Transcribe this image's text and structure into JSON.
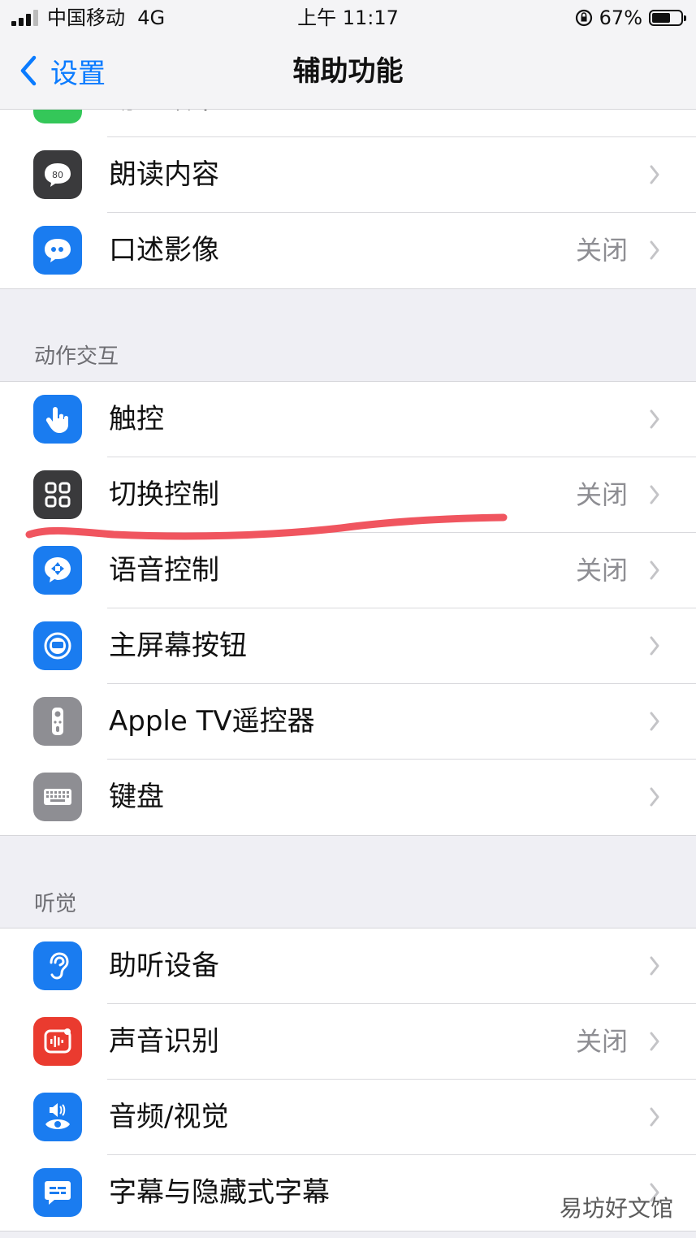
{
  "status_bar": {
    "carrier": "中国移动",
    "network": "4G",
    "time": "上午 11:17",
    "battery": "67%"
  },
  "nav": {
    "back_label": "设置",
    "title": "辅助功能"
  },
  "group_top": {
    "partial_label": "动态效果",
    "items": [
      {
        "label": "朗读内容",
        "value": ""
      },
      {
        "label": "口述影像",
        "value": "关闭"
      }
    ]
  },
  "section_motion": {
    "header": "动作交互",
    "items": [
      {
        "label": "触控",
        "value": ""
      },
      {
        "label": "切换控制",
        "value": "关闭"
      },
      {
        "label": "语音控制",
        "value": "关闭"
      },
      {
        "label": "主屏幕按钮",
        "value": ""
      },
      {
        "label": "Apple TV遥控器",
        "value": ""
      },
      {
        "label": "键盘",
        "value": ""
      }
    ]
  },
  "section_hearing": {
    "header": "听觉",
    "items": [
      {
        "label": "助听设备",
        "value": ""
      },
      {
        "label": "声音识别",
        "value": "关闭"
      },
      {
        "label": "音频/视觉",
        "value": ""
      },
      {
        "label": "字幕与隐藏式字幕",
        "value": ""
      }
    ]
  },
  "icons": {
    "spoken-content": "#3a3a3c",
    "audio-descriptions": "#1a7cf0",
    "touch": "#1a7cf0",
    "switch-control": "#3a3a3c",
    "voice-control": "#1a7cf0",
    "home-button": "#1a7cf0",
    "apple-tv-remote": "#8e8e93",
    "keyboard": "#8e8e93",
    "hearing-devices": "#1a7cf0",
    "sound-recognition": "#ea3b2f",
    "audio-visual": "#1a7cf0",
    "subtitles": "#1a7cf0"
  },
  "annotation_color": "#f0555f",
  "watermark": "易坊好文馆"
}
